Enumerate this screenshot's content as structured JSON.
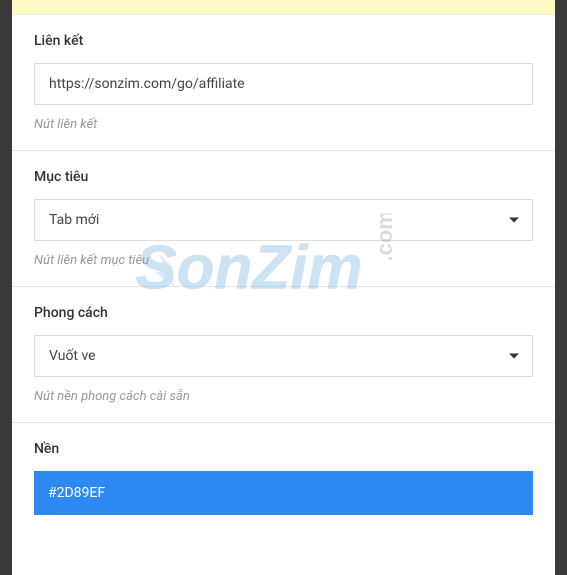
{
  "sections": {
    "link": {
      "label": "Liên kết",
      "value": "https://sonzim.com/go/affiliate",
      "help": "Nút liên kết"
    },
    "target": {
      "label": "Mục tiêu",
      "selected": "Tab mới",
      "help": "Nút liên kết mục tiêu"
    },
    "style": {
      "label": "Phong cách",
      "selected": "Vuốt ve",
      "help": "Nút nền phong cách cài sẵn"
    },
    "background": {
      "label": "Nền",
      "value": "#2D89EF"
    }
  },
  "watermark": {
    "text": "SonZim",
    "domain": ".com"
  }
}
